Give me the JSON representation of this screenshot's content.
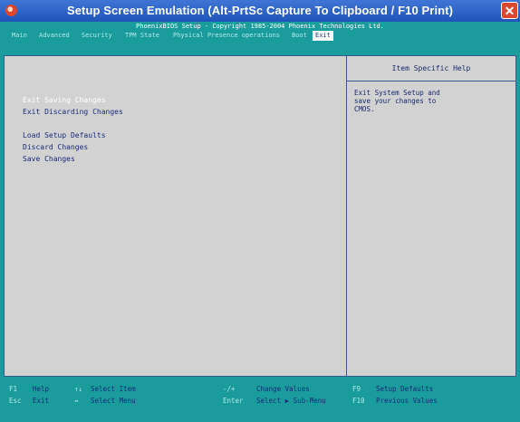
{
  "window": {
    "title": "Setup Screen Emulation (Alt-PrtSc Capture To Clipboard / F10 Print)",
    "close_glyph": "✕"
  },
  "bios": {
    "header": "PhoenixBIOS Setup - Copyright 1985-2004 Phoenix Technologies Ltd.",
    "menu": [
      {
        "label": "Main"
      },
      {
        "label": "Advanced"
      },
      {
        "label": "Security"
      },
      {
        "label": "TPM State"
      },
      {
        "label": "Physical Presence operations"
      },
      {
        "label": "Boot"
      },
      {
        "label": "Exit",
        "active": true
      }
    ],
    "items": [
      {
        "label": "Exit Saving Changes",
        "selected": true
      },
      {
        "label": "Exit Discarding Changes"
      },
      {
        "label": "Load Setup Defaults"
      },
      {
        "label": "Discard Changes"
      },
      {
        "label": "Save Changes"
      }
    ],
    "help": {
      "title": "Item Specific Help",
      "text": "Exit System Setup and\nsave your changes to\nCMOS."
    },
    "footer": [
      {
        "key": "F1",
        "desc": "Help"
      },
      {
        "key": "Esc",
        "desc": "Exit"
      },
      {
        "key": "↑↓",
        "desc": "Select Item"
      },
      {
        "key": "↔",
        "desc": "Select Menu"
      },
      {
        "key": "-/+",
        "desc": "Change Values"
      },
      {
        "key": "Enter",
        "desc": "Select ▶ Sub-Menu"
      },
      {
        "key": "F9",
        "desc": "Setup Defaults"
      },
      {
        "key": "F10",
        "desc": "Previous Values"
      }
    ]
  },
  "colors": {
    "bios_cyan": "#1a9c9c",
    "panel_gray": "#d2d2d2",
    "text_blue": "#1a2a7a",
    "title_blue": "#2a62c8",
    "close_red": "#d9482f"
  }
}
